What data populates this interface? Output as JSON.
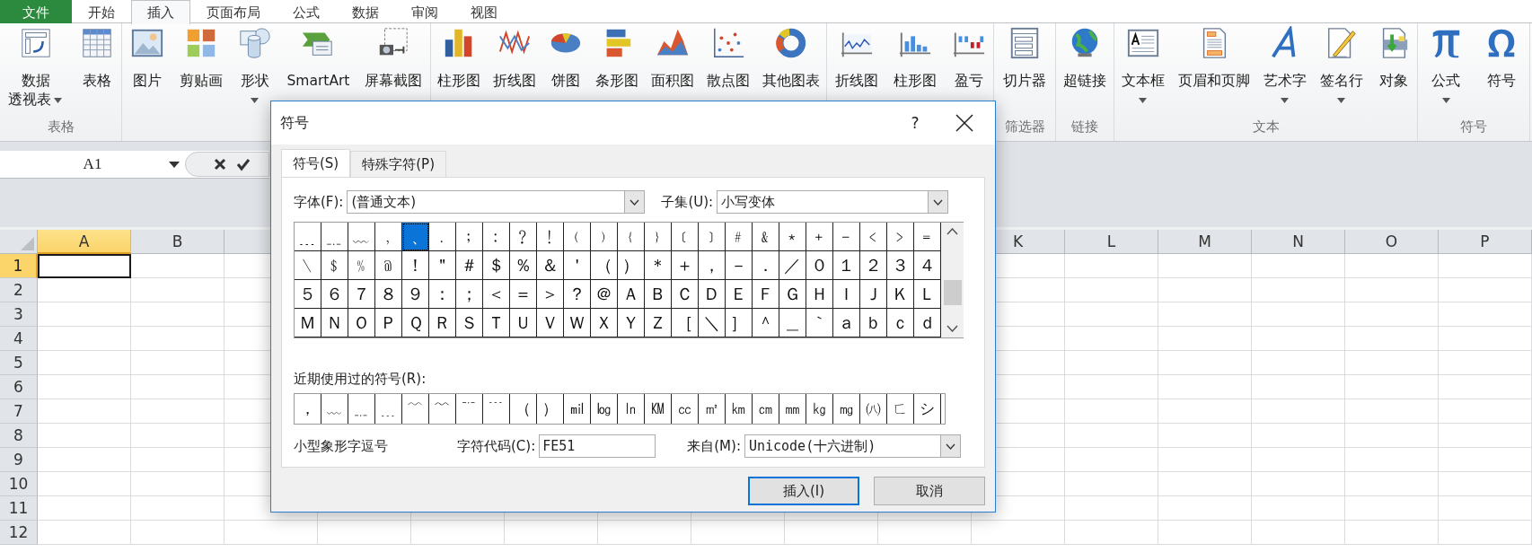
{
  "tabs": [
    {
      "label": "文件",
      "kind": "file",
      "selected": false
    },
    {
      "label": "开始",
      "kind": "tab",
      "selected": false
    },
    {
      "label": "插入",
      "kind": "tab",
      "selected": true
    },
    {
      "label": "页面布局",
      "kind": "tab",
      "selected": false
    },
    {
      "label": "公式",
      "kind": "tab",
      "selected": false
    },
    {
      "label": "数据",
      "kind": "tab",
      "selected": false
    },
    {
      "label": "审阅",
      "kind": "tab",
      "selected": false
    },
    {
      "label": "视图",
      "kind": "tab",
      "selected": false
    }
  ],
  "ribbon_groups": [
    {
      "label": "表格",
      "buttons": [
        {
          "lines": [
            "数据",
            "透视表"
          ],
          "dropdown": true
        },
        {
          "label": "表格",
          "dropdown": false
        }
      ]
    },
    {
      "buttons": [
        {
          "label": "图片",
          "dropdown": false
        },
        {
          "label": "剪贴画",
          "dropdown": false
        },
        {
          "label": "形状",
          "dropdown": true
        },
        {
          "label": "SmartArt",
          "dropdown": false
        },
        {
          "label": "屏幕截图",
          "dropdown": false
        }
      ]
    },
    {
      "buttons": [
        {
          "label": "柱形图",
          "dropdown": false
        },
        {
          "label": "折线图",
          "dropdown": false
        },
        {
          "label": "饼图",
          "dropdown": false
        },
        {
          "label": "条形图",
          "dropdown": false
        },
        {
          "label": "面积图",
          "dropdown": false
        },
        {
          "label": "散点图",
          "dropdown": false
        },
        {
          "label": "其他图表",
          "dropdown": false
        }
      ]
    },
    {
      "buttons": [
        {
          "label": "折线图",
          "dropdown": false
        },
        {
          "label": "柱形图",
          "dropdown": false
        },
        {
          "label": "盈亏",
          "dropdown": false
        }
      ]
    },
    {
      "label": "筛选器",
      "buttons": [
        {
          "label": "切片器",
          "dropdown": false
        }
      ]
    },
    {
      "label": "链接",
      "buttons": [
        {
          "label": "超链接",
          "dropdown": false
        }
      ]
    },
    {
      "label": "文本",
      "buttons": [
        {
          "label": "文本框",
          "dropdown": true
        },
        {
          "label": "页眉和页脚",
          "dropdown": false
        },
        {
          "label": "艺术字",
          "dropdown": true
        },
        {
          "label": "签名行",
          "dropdown": true
        },
        {
          "label": "对象",
          "dropdown": false
        }
      ]
    },
    {
      "label": "符号",
      "buttons": [
        {
          "label": "公式",
          "dropdown": true
        },
        {
          "label": "符号",
          "dropdown": false
        }
      ]
    }
  ],
  "formula_bar": {
    "name_box": "A1"
  },
  "sheet": {
    "columns_left": [
      {
        "label": "A",
        "selected": true
      },
      {
        "label": "B",
        "selected": false
      }
    ],
    "columns_right": [
      {
        "label": "K",
        "selected": false
      },
      {
        "label": "L",
        "selected": false
      },
      {
        "label": "M",
        "selected": false
      },
      {
        "label": "N",
        "selected": false
      },
      {
        "label": "O",
        "selected": false
      },
      {
        "label": "P",
        "selected": false
      }
    ],
    "rows": [
      {
        "label": "1",
        "selected": true
      },
      {
        "label": "2",
        "selected": false
      },
      {
        "label": "3",
        "selected": false
      },
      {
        "label": "4",
        "selected": false
      },
      {
        "label": "5",
        "selected": false
      },
      {
        "label": "6",
        "selected": false
      },
      {
        "label": "7",
        "selected": false
      },
      {
        "label": "8",
        "selected": false
      },
      {
        "label": "9",
        "selected": false
      },
      {
        "label": "10",
        "selected": false
      },
      {
        "label": "11",
        "selected": false
      },
      {
        "label": "12",
        "selected": false
      }
    ]
  },
  "dialog": {
    "title": "符号",
    "help": "?",
    "tabs": [
      {
        "label": "符号(S)",
        "selected": true
      },
      {
        "label": "特殊字符(P)",
        "selected": false
      }
    ],
    "font": {
      "label": "字体(F):",
      "value": "(普通文本)"
    },
    "subset": {
      "label": "子集(U):",
      "value": "小写变体"
    },
    "symbol_rows": [
      [
        {
          "symbol": "﹍",
          "selected": false
        },
        {
          "symbol": "﹎",
          "selected": false
        },
        {
          "symbol": "﹏",
          "selected": false
        },
        {
          "symbol": "﹐",
          "selected": false
        },
        {
          "symbol": "﹑",
          "selected": true
        },
        {
          "symbol": "﹒",
          "selected": false
        },
        {
          "symbol": "﹔",
          "selected": false
        },
        {
          "symbol": "﹕",
          "selected": false
        },
        {
          "symbol": "﹖",
          "selected": false
        },
        {
          "symbol": "﹗",
          "selected": false
        },
        {
          "symbol": "﹙",
          "selected": false
        },
        {
          "symbol": "﹚",
          "selected": false
        },
        {
          "symbol": "﹛",
          "selected": false
        },
        {
          "symbol": "﹜",
          "selected": false
        },
        {
          "symbol": "﹝",
          "selected": false
        },
        {
          "symbol": "﹞",
          "selected": false
        },
        {
          "symbol": "﹟",
          "selected": false
        },
        {
          "symbol": "﹠",
          "selected": false
        },
        {
          "symbol": "﹡",
          "selected": false
        },
        {
          "symbol": "﹢",
          "selected": false
        },
        {
          "symbol": "﹣",
          "selected": false
        },
        {
          "symbol": "﹤",
          "selected": false
        },
        {
          "symbol": "﹥",
          "selected": false
        },
        {
          "symbol": "﹦",
          "selected": false
        }
      ],
      [
        {
          "symbol": "﹨",
          "selected": false
        },
        {
          "symbol": "﹩",
          "selected": false
        },
        {
          "symbol": "﹪",
          "selected": false
        },
        {
          "symbol": "﹫",
          "selected": false
        },
        {
          "symbol": "！",
          "selected": false
        },
        {
          "symbol": "＂",
          "selected": false
        },
        {
          "symbol": "＃",
          "selected": false
        },
        {
          "symbol": "＄",
          "selected": false
        },
        {
          "symbol": "％",
          "selected": false
        },
        {
          "symbol": "＆",
          "selected": false
        },
        {
          "symbol": "＇",
          "selected": false
        },
        {
          "symbol": "（",
          "selected": false
        },
        {
          "symbol": "）",
          "selected": false
        },
        {
          "symbol": "＊",
          "selected": false
        },
        {
          "symbol": "＋",
          "selected": false
        },
        {
          "symbol": "，",
          "selected": false
        },
        {
          "symbol": "－",
          "selected": false
        },
        {
          "symbol": "．",
          "selected": false
        },
        {
          "symbol": "／",
          "selected": false
        },
        {
          "symbol": "０",
          "selected": false
        },
        {
          "symbol": "１",
          "selected": false
        },
        {
          "symbol": "２",
          "selected": false
        },
        {
          "symbol": "３",
          "selected": false
        },
        {
          "symbol": "４",
          "selected": false
        }
      ],
      [
        {
          "symbol": "５",
          "selected": false
        },
        {
          "symbol": "６",
          "selected": false
        },
        {
          "symbol": "７",
          "selected": false
        },
        {
          "symbol": "８",
          "selected": false
        },
        {
          "symbol": "９",
          "selected": false
        },
        {
          "symbol": "：",
          "selected": false
        },
        {
          "symbol": "；",
          "selected": false
        },
        {
          "symbol": "＜",
          "selected": false
        },
        {
          "symbol": "＝",
          "selected": false
        },
        {
          "symbol": "＞",
          "selected": false
        },
        {
          "symbol": "？",
          "selected": false
        },
        {
          "symbol": "＠",
          "selected": false
        },
        {
          "symbol": "Ａ",
          "selected": false
        },
        {
          "symbol": "Ｂ",
          "selected": false
        },
        {
          "symbol": "Ｃ",
          "selected": false
        },
        {
          "symbol": "Ｄ",
          "selected": false
        },
        {
          "symbol": "Ｅ",
          "selected": false
        },
        {
          "symbol": "Ｆ",
          "selected": false
        },
        {
          "symbol": "Ｇ",
          "selected": false
        },
        {
          "symbol": "Ｈ",
          "selected": false
        },
        {
          "symbol": "Ｉ",
          "selected": false
        },
        {
          "symbol": "Ｊ",
          "selected": false
        },
        {
          "symbol": "Ｋ",
          "selected": false
        },
        {
          "symbol": "Ｌ",
          "selected": false
        }
      ],
      [
        {
          "symbol": "Ｍ",
          "selected": false
        },
        {
          "symbol": "Ｎ",
          "selected": false
        },
        {
          "symbol": "Ｏ",
          "selected": false
        },
        {
          "symbol": "Ｐ",
          "selected": false
        },
        {
          "symbol": "Ｑ",
          "selected": false
        },
        {
          "symbol": "Ｒ",
          "selected": false
        },
        {
          "symbol": "Ｓ",
          "selected": false
        },
        {
          "symbol": "Ｔ",
          "selected": false
        },
        {
          "symbol": "Ｕ",
          "selected": false
        },
        {
          "symbol": "Ｖ",
          "selected": false
        },
        {
          "symbol": "Ｗ",
          "selected": false
        },
        {
          "symbol": "Ｘ",
          "selected": false
        },
        {
          "symbol": "Ｙ",
          "selected": false
        },
        {
          "symbol": "Ｚ",
          "selected": false
        },
        {
          "symbol": "［",
          "selected": false
        },
        {
          "symbol": "＼",
          "selected": false
        },
        {
          "symbol": "］",
          "selected": false
        },
        {
          "symbol": "＾",
          "selected": false
        },
        {
          "symbol": "＿",
          "selected": false
        },
        {
          "symbol": "｀",
          "selected": false
        },
        {
          "symbol": "ａ",
          "selected": false
        },
        {
          "symbol": "ｂ",
          "selected": false
        },
        {
          "symbol": "ｃ",
          "selected": false
        },
        {
          "symbol": "ｄ",
          "selected": false
        }
      ]
    ],
    "recent_label": "近期使用过的符号(R):",
    "recent": [
      "，",
      "﹏",
      "﹎",
      "﹍",
      "﹋",
      "﹌",
      "﹊",
      "﹉",
      "（",
      "）",
      "㏕",
      "㏒",
      "㏑",
      "㏎",
      "㏄",
      "㎡",
      "㎞",
      "㎝",
      "㎜",
      "㎏",
      "㎎",
      "㈧",
      "ㄈ",
      "シ"
    ],
    "description": "小型象形字逗号",
    "char_code": {
      "label": "字符代码(C):",
      "value": "FE51"
    },
    "from": {
      "label": "来自(M):",
      "value": "Unicode(十六进制)"
    },
    "buttons": [
      {
        "label": "插入(I)",
        "default": true
      },
      {
        "label": "取消",
        "default": false
      }
    ]
  }
}
